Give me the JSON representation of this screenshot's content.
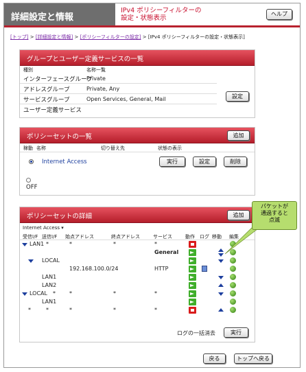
{
  "header": {
    "title": "詳細設定と情報",
    "subtitle_line1": "IPv4 ポリシーフィルターの",
    "subtitle_line2": "設定・状態表示",
    "help_label": "ヘルプ"
  },
  "breadcrumb": {
    "top": "[トップ]",
    "detail": "[詳細設定と情報]",
    "policy": "[ポリシーフィルターの設定]",
    "current": "> [IPv4 ポリシーフィルターの設定・状態表示]",
    "sep": ">"
  },
  "groups": {
    "title": "グループとユーザー定義サービスの一覧",
    "col_type": "種別",
    "col_names": "名称一覧",
    "rows": [
      {
        "type": "インターフェースグループ",
        "names": "Private"
      },
      {
        "type": "アドレスグループ",
        "names": "Private, Any"
      },
      {
        "type": "サービスグループ",
        "names": "Open Services, General, Mail"
      },
      {
        "type": "ユーザー定義サービス",
        "names": ""
      }
    ],
    "settings_button": "設定"
  },
  "policyset": {
    "title": "ポリシーセットの一覧",
    "add_button": "追加",
    "col_active": "稼動",
    "col_name": "名称",
    "col_switch": "切り替え先",
    "col_status": "状態の表示",
    "entry_name": "Internet Access",
    "run": "実行",
    "settings": "設定",
    "delete": "削除",
    "off_label": "OFF"
  },
  "details": {
    "title": "ポリシーセットの詳細",
    "add_button": "追加",
    "selected_set": "Internet Access",
    "columns": [
      "受信I/F",
      "送信I/F",
      "始点アドレス",
      "終点アドレス",
      "サービス",
      "動作",
      "ログ",
      "移動",
      "編集"
    ],
    "rows": [
      {
        "in": "LAN1",
        "out": "*",
        "src": "*",
        "dst": "*",
        "svc": "*"
      },
      {
        "in": "",
        "out": "",
        "src": "",
        "dst": "",
        "svc": "General"
      },
      {
        "in": "",
        "out": "LOCAL",
        "src": "",
        "dst": "",
        "svc": ""
      },
      {
        "in": "",
        "out": "",
        "src": "192.168.100.0/24",
        "dst": "",
        "svc": "HTTP"
      },
      {
        "in": "",
        "out": "LAN1",
        "src": "",
        "dst": "",
        "svc": ""
      },
      {
        "in": "",
        "out": "LAN2",
        "src": "",
        "dst": "",
        "svc": ""
      },
      {
        "in": "LOCAL",
        "out": "*",
        "src": "*",
        "dst": "*",
        "svc": "*"
      },
      {
        "in": "",
        "out": "LAN1",
        "src": "",
        "dst": "",
        "svc": ""
      },
      {
        "in": "*",
        "out": "*",
        "src": "*",
        "dst": "*",
        "svc": "*"
      }
    ],
    "log_clear_label": "ログの一括消去",
    "log_clear_button": "実行"
  },
  "callout": {
    "line1": "パケットが",
    "line2": "通過すると",
    "line3": "点滅"
  },
  "footer": {
    "back": "戻る",
    "top": "トップへ戻る"
  }
}
